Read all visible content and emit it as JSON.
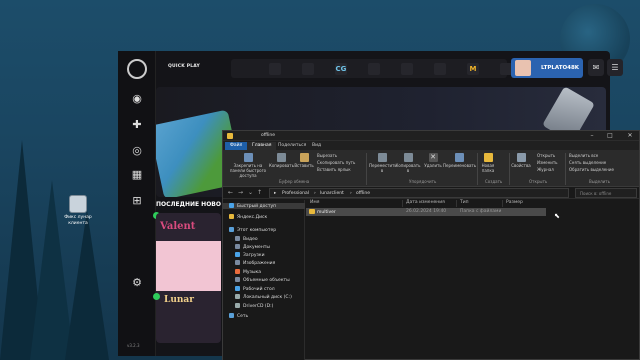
{
  "desktop": {
    "icon_label": "Фикс лунар клиента"
  },
  "launcher": {
    "quick_play": "QUICK PLAY",
    "servers": [
      {
        "icon": "server-logo",
        "text": "",
        "color": "#e84b9a"
      },
      {
        "icon": "server-logo",
        "text": "",
        "color": "#f2c94c"
      },
      {
        "icon": "server-logo",
        "text": "CG",
        "color": "#6fc3e8"
      },
      {
        "icon": "server-logo",
        "text": "",
        "color": "#c76b3a"
      },
      {
        "icon": "server-logo",
        "text": "",
        "color": "#7bc84a"
      },
      {
        "icon": "server-logo",
        "text": "",
        "color": "#e9a233"
      },
      {
        "icon": "server-logo",
        "text": "M",
        "color": "#f0b429"
      },
      {
        "icon": "server-logo",
        "text": "",
        "color": "#9b7bd8"
      }
    ],
    "username": "LTPLATO48K",
    "news_title": "ПОСЛЕДНИЕ НОВО",
    "news_card_title": "Valent",
    "news_card_title2": "Lunar",
    "version": "v3.2.3"
  },
  "explorer": {
    "title": "offline",
    "tabs": [
      "Файл",
      "Главная",
      "Поделиться",
      "Вид"
    ],
    "ribbon": {
      "pin": "Закрепить на панели быстрого доступа",
      "copy": "Копировать",
      "paste": "Вставить",
      "cut": "Вырезать",
      "copy_path": "Скопировать путь",
      "paste_shortcut": "Вставить ярлык",
      "clipboard_group": "Буфер обмена",
      "move_to": "Переместить в",
      "copy_to": "Копировать в",
      "delete": "Удалить",
      "rename": "Переименовать",
      "organize_group": "Упорядочить",
      "new_folder": "Новая папка",
      "create_group": "Создать",
      "properties": "Свойства",
      "open": "Открыть",
      "edit": "Изменить",
      "history": "Журнал",
      "open_group": "Открыть",
      "select_all": "Выделить все",
      "select_none": "Снять выделение",
      "invert": "Обратить выделение",
      "select_group": "Выделить"
    },
    "path": [
      "Professional",
      "lunarclient",
      "offline"
    ],
    "search_placeholder": "Поиск в: offline",
    "nav": [
      {
        "label": "Быстрый доступ",
        "icon": "star-icon",
        "color": "#4aa3e8"
      },
      {
        "label": "Яндекс.Диск",
        "icon": "cloud-icon",
        "color": "#e8b93c"
      },
      {
        "label": "Этот компьютер",
        "icon": "computer-icon",
        "color": "#5aa0d8"
      },
      {
        "label": "Видео",
        "icon": "video-icon",
        "color": "#7a8aa0"
      },
      {
        "label": "Документы",
        "icon": "documents-icon",
        "color": "#7a8aa0"
      },
      {
        "label": "Загрузки",
        "icon": "downloads-icon",
        "color": "#4aa3e8"
      },
      {
        "label": "Изображения",
        "icon": "pictures-icon",
        "color": "#7a8aa0"
      },
      {
        "label": "Музыка",
        "icon": "music-icon",
        "color": "#e86b3c"
      },
      {
        "label": "Объемные объекты",
        "icon": "3d-objects-icon",
        "color": "#7a8aa0"
      },
      {
        "label": "Рабочий стол",
        "icon": "desktop-icon",
        "color": "#4aa3e8"
      },
      {
        "label": "Локальный диск (C:)",
        "icon": "drive-icon",
        "color": "#9aa"
      },
      {
        "label": "DriverCD (D:)",
        "icon": "drive-icon",
        "color": "#9aa"
      },
      {
        "label": "Сеть",
        "icon": "network-icon",
        "color": "#5aa0d8"
      }
    ],
    "columns": [
      "Имя",
      "Дата изменения",
      "Тип",
      "Размер"
    ],
    "file": {
      "name": "multiver",
      "date": "26.02.2024 19:40",
      "type": "Папка с файлами",
      "size": ""
    }
  }
}
